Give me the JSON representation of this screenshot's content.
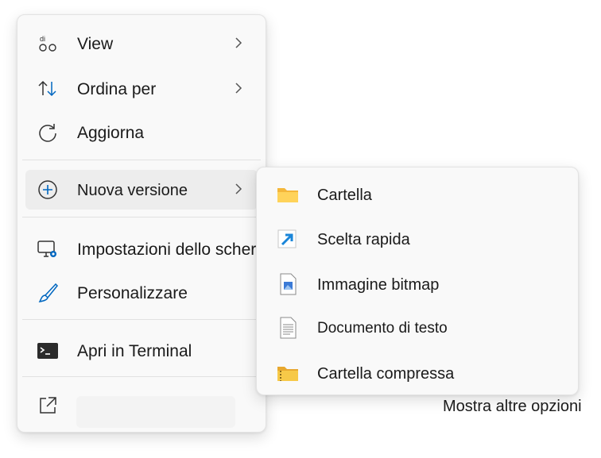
{
  "main_menu": {
    "items": [
      {
        "label": "View",
        "icon": "view-icon"
      },
      {
        "label": "Ordina per",
        "icon": "sort-icon"
      },
      {
        "label": "Aggiorna",
        "icon": "refresh-icon"
      },
      {
        "label": "Nuova versione",
        "icon": "plus-circle-icon"
      },
      {
        "label": "Impostazioni dello schermo",
        "icon": "display-settings-icon"
      },
      {
        "label": "Personalizzare",
        "icon": "brush-icon"
      },
      {
        "label": "Apri in Terminal",
        "icon": "terminal-icon"
      }
    ],
    "view_icon_text": "di",
    "bottom_icon": "open-external-icon"
  },
  "submenu": {
    "items": [
      {
        "label": "Cartella",
        "icon": "folder-icon"
      },
      {
        "label": "Scelta rapida",
        "icon": "shortcut-icon"
      },
      {
        "label": "Immagine bitmap",
        "icon": "bitmap-icon"
      },
      {
        "label": "Documento di testo",
        "icon": "text-document-icon"
      },
      {
        "label": "Cartella compressa",
        "icon": "zip-folder-icon"
      }
    ]
  },
  "more_options_label": "Mostra altre opzioni",
  "colors": {
    "accent": "#0067c0",
    "folder": "#f7c948",
    "menu_bg": "#f9f9f9",
    "hover_bg": "#ededed"
  }
}
